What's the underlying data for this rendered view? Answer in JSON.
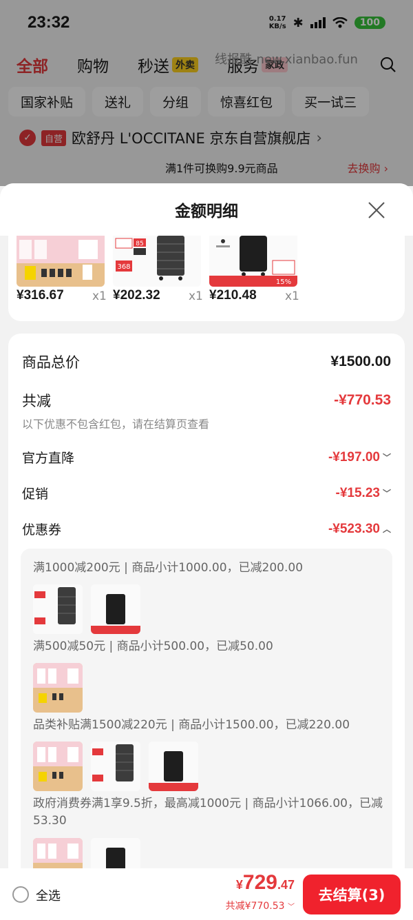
{
  "status_bar": {
    "time": "23:32",
    "speed": "0.17",
    "speed_unit": "KB/s",
    "battery": "100"
  },
  "nav": {
    "tabs": [
      {
        "label": "全部",
        "active": true
      },
      {
        "label": "购物"
      },
      {
        "label": "秒送",
        "tag": "外卖"
      },
      {
        "label": "服务",
        "tag": "家政"
      }
    ],
    "watermark": "线报酷-new.xianbao.fun"
  },
  "chips": [
    "国家补贴",
    "送礼",
    "分组",
    "惊喜红包",
    "买一试三"
  ],
  "store": {
    "badge": "自营",
    "name": "欧舒丹 L'OCCITANE 京东自营旗舰店",
    "arrow": "›"
  },
  "swap": {
    "text": "满1件可换购9.9元商品",
    "link": "去换购 ›"
  },
  "sheet": {
    "title": "金额明细",
    "products": [
      {
        "price": "¥316.67",
        "qty": "x1"
      },
      {
        "price": "¥202.32",
        "qty": "x1"
      },
      {
        "price": "¥210.48",
        "qty": "x1"
      }
    ],
    "goods_total": {
      "label": "商品总价",
      "amount": "¥1500.00"
    },
    "total_discount": {
      "label": "共减",
      "amount": "-¥770.53",
      "note": "以下优惠不包含红包，请在结算页查看"
    },
    "official_drop": {
      "label": "官方直降",
      "amount": "-¥197.00"
    },
    "promotion": {
      "label": "促销",
      "amount": "-¥15.23"
    },
    "coupon": {
      "label": "优惠券",
      "amount": "-¥523.30"
    },
    "coupon_items": [
      "满1000减200元 | 商品小计1000.00，已减200.00",
      "满500减50元 | 商品小计500.00，已减50.00",
      "品类补贴满1500减220元 | 商品小计1500.00，已减220.00",
      "政府消费券满1享9.5折，最高减1000元 | 商品小计1066.00，已减53.30"
    ],
    "thumb_badges": {
      "price_tag": "368",
      "sale": "85",
      "promo": "15%"
    }
  },
  "bottom_bar": {
    "select_all": "全选",
    "price_yen": "¥",
    "price_int": "729",
    "price_dec": ".47",
    "saved": "共减¥770.53",
    "checkout": "去结算(3)"
  },
  "colors": {
    "accent": "#e4393c",
    "button": "#f0222d"
  }
}
